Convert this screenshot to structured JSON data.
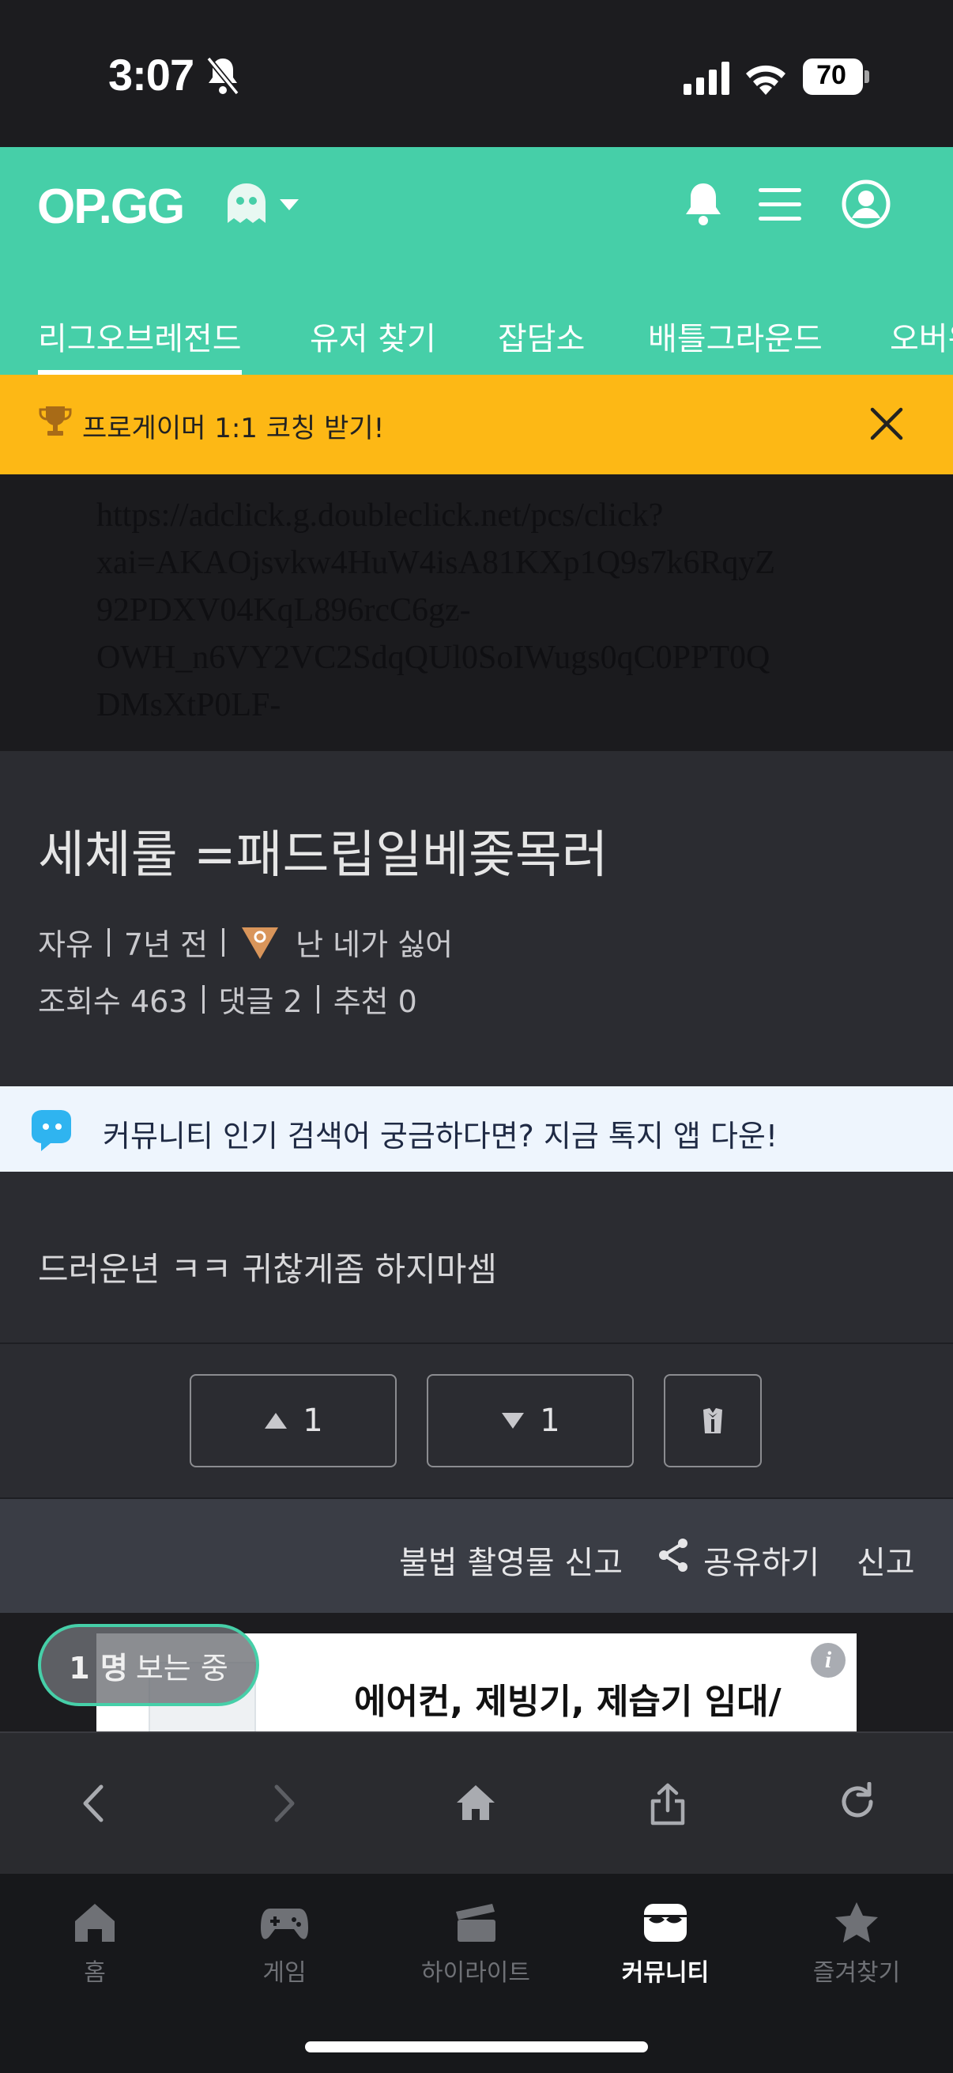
{
  "status_bar": {
    "time": "3:07",
    "battery": "70"
  },
  "header": {
    "logo": "OP.GG",
    "tabs": [
      "리그오브레전드",
      "유저 찾기",
      "잡담소",
      "배틀그라운드",
      "오버워치"
    ]
  },
  "promo": {
    "icon": "trophy-icon",
    "text": "프로게이머 1:1 코칭 받기!"
  },
  "ad_url": {
    "lines": [
      "https://adclick.g.doubleclick.net/pcs/click?",
      "xai=AKAOjsvkw4HuW4isA81KXp1Q9s7k6RqyZ",
      "92PDXV04KqL896rcC6gz-",
      "OWH_n6VY2VC2SdqQUl0SoIWugs0qC0PPT0Q",
      "DMsXtP0LF-"
    ]
  },
  "post": {
    "title": "세체룰 =패드립일베좆목러",
    "category": "자유",
    "time_ago": "7년 전",
    "author": "난 네가 싫어",
    "views": "조회수 463",
    "comments": "댓글 2",
    "recommend": "추천 0"
  },
  "community_banner": {
    "text": "커뮤니티 인기 검색어 궁금하다면? 지금 톡지 앱 다운!"
  },
  "body": {
    "text": "드러운년 ㅋㅋ 귀찮게좀 하지마셈"
  },
  "votes": {
    "up": "1",
    "down": "1"
  },
  "actions": {
    "illegal_report": "불법 촬영물 신고",
    "share": "공유하기",
    "report": "신고"
  },
  "ad": {
    "title": "에어컨, 제빙기, 제습기 임대/",
    "info": "i"
  },
  "viewers": {
    "count": "1 명",
    "label": "보는 중"
  },
  "bottom_tabs": [
    "홈",
    "게임",
    "하이라이트",
    "커뮤니티",
    "즐겨찾기"
  ],
  "colors": {
    "brand": "#46cfa8",
    "promo": "#fdb815"
  }
}
